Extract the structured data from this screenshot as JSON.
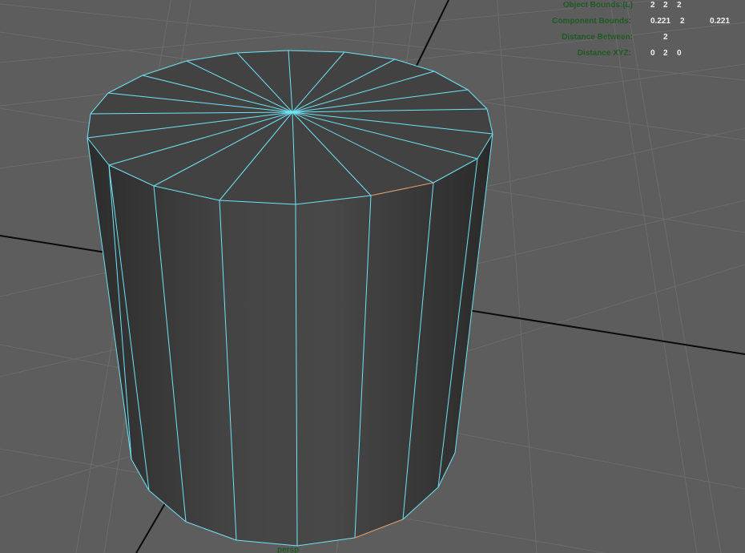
{
  "viewport": {
    "camera_name": "persp",
    "background_color": "#5d5d5d",
    "grid_color": "#6b6b6b",
    "axis_color": "#0a0a0a",
    "wireframe_color": "#6fe3f5",
    "selected_edge_color": "#e8a070",
    "hud_label_color": "#1f5a22",
    "hud_value_color": "#f2f2f2"
  },
  "hud": {
    "object_bounds": {
      "label": "Object Bounds:(L)",
      "values": [
        "2",
        "2",
        "2"
      ]
    },
    "component_bounds": {
      "label": "Component Bounds:",
      "values": [
        "0.221",
        "2",
        "0.221"
      ]
    },
    "distance_between": {
      "label": "Distance Between:",
      "value": "2"
    },
    "distance_xyz": {
      "label": "Distance XYZ:",
      "values": [
        "0",
        "2",
        "0"
      ]
    }
  },
  "object": {
    "name_icon": "cylinder-mesh-icon"
  }
}
